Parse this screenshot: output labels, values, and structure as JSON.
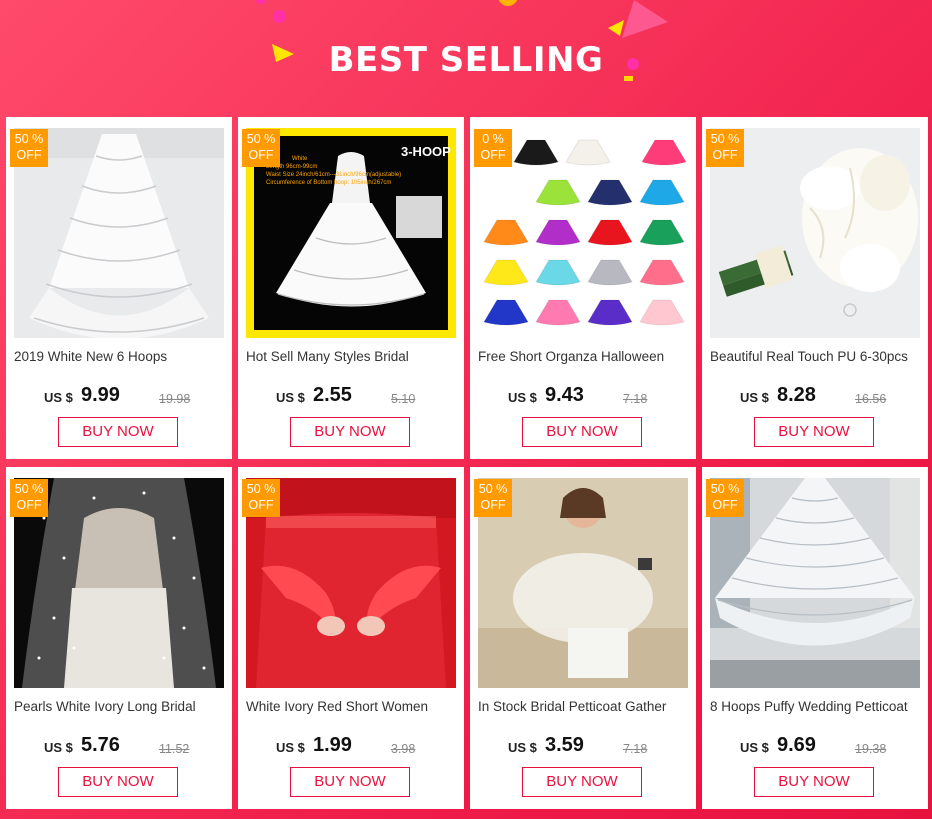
{
  "header": {
    "title": "BEST SELLING"
  },
  "colors": {
    "accent": "#e8123f",
    "badge": "#ff9a00",
    "background": "#f7345a"
  },
  "products": [
    {
      "badge_top": "50 %",
      "badge_bottom": "OFF",
      "name": "2019 White New 6 Hoops",
      "currency": "US $",
      "price": "9.99",
      "old_price": "19.98",
      "button": "BUY NOW",
      "image": "white-6-hoop-petticoat"
    },
    {
      "badge_top": "50 %",
      "badge_bottom": "OFF",
      "name": "Hot Sell Many Styles Bridal",
      "currency": "US $",
      "price": "2.55",
      "old_price": "5.10",
      "button": "BUY NOW",
      "image": "3-hoop-petticoat-yellow-frame",
      "image_text": {
        "label": "3-HOOP",
        "line1": "White",
        "line2": "Length   96cm-99cm",
        "line3": "Waist Size  24inch/61cm---31inch/96cm(adjustable)",
        "line4": "Circumference of Bottom hoop: 105inch/267cm"
      }
    },
    {
      "badge_top": "0 %",
      "badge_bottom": "OFF",
      "name": "Free Short Organza Halloween",
      "currency": "US $",
      "price": "9.43",
      "old_price": "7.18",
      "button": "BUY NOW",
      "image": "colorful-tutu-grid"
    },
    {
      "badge_top": "50 %",
      "badge_bottom": "OFF",
      "name": "Beautiful Real Touch PU 6-30pcs",
      "currency": "US $",
      "price": "8.28",
      "old_price": "16.56",
      "button": "BUY NOW",
      "image": "white-calla-bouquet"
    },
    {
      "badge_top": "50 %",
      "badge_bottom": "OFF",
      "name": "Pearls White Ivory Long Bridal",
      "currency": "US $",
      "price": "5.76",
      "old_price": "11.52",
      "button": "BUY NOW",
      "image": "pearl-veil"
    },
    {
      "badge_top": "50 %",
      "badge_bottom": "OFF",
      "name": "White Ivory Red Short Women",
      "currency": "US $",
      "price": "1.99",
      "old_price": "3.98",
      "button": "BUY NOW",
      "image": "red-lace-gloves"
    },
    {
      "badge_top": "50 %",
      "badge_bottom": "OFF",
      "name": "In Stock Bridal Petticoat Gather",
      "currency": "US $",
      "price": "3.59",
      "old_price": "7.18",
      "button": "BUY NOW",
      "image": "petticoat-gather-bathroom"
    },
    {
      "badge_top": "50 %",
      "badge_bottom": "OFF",
      "name": "8 Hoops Puffy Wedding Petticoat",
      "currency": "US $",
      "price": "9.69",
      "old_price": "19.38",
      "button": "BUY NOW",
      "image": "8-hoop-petticoat"
    }
  ]
}
